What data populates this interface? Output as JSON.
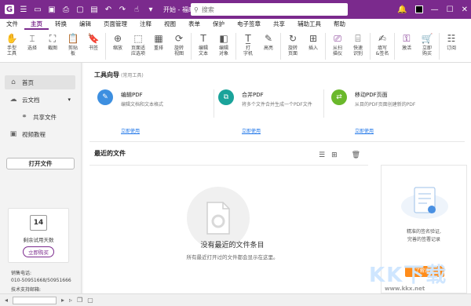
{
  "titlebar": {
    "title": "开始 - 福昕高级PDF...",
    "search_placeholder": "搜索",
    "bg_color": "#7b2a8d"
  },
  "menu": [
    "文件",
    "主页",
    "转换",
    "编辑",
    "页面管理",
    "注释",
    "视图",
    "表单",
    "保护",
    "电子签章",
    "共享",
    "辅助工具",
    "帮助"
  ],
  "ribbon": [
    {
      "label": "手型\n工具",
      "icon": "hand-icon"
    },
    {
      "label": "选择",
      "icon": "select-icon"
    },
    {
      "label": "截图",
      "icon": "screenshot-icon"
    },
    {
      "label": "剪贴\n板",
      "icon": "clipboard-icon"
    },
    {
      "label": "书签",
      "icon": "bookmark-icon"
    },
    {
      "label": "缩放",
      "icon": "zoom-icon"
    },
    {
      "label": "页面适\n应选项",
      "icon": "fit-page-icon"
    },
    {
      "label": "重排",
      "icon": "reflow-icon"
    },
    {
      "label": "旋转\n视图",
      "icon": "rotate-view-icon"
    },
    {
      "label": "编辑\n文本",
      "icon": "edit-text-icon"
    },
    {
      "label": "编辑\n对象",
      "icon": "edit-object-icon"
    },
    {
      "label": "打\n字机",
      "icon": "typewriter-icon"
    },
    {
      "label": "高亮",
      "icon": "highlight-icon"
    },
    {
      "label": "旋转\n页面",
      "icon": "rotate-page-icon"
    },
    {
      "label": "插入",
      "icon": "insert-icon"
    },
    {
      "label": "从扫\n描仪",
      "icon": "scanner-icon"
    },
    {
      "label": "快速\n识别",
      "icon": "ocr-icon"
    },
    {
      "label": "填写\n&签名",
      "icon": "fill-sign-icon"
    },
    {
      "label": "激活",
      "icon": "activate-icon"
    },
    {
      "label": "立即\n购买",
      "icon": "cart-icon"
    },
    {
      "label": "订阅",
      "icon": "subscribe-icon"
    }
  ],
  "sidebar": {
    "home": "首页",
    "cloud": "云文档",
    "shared": "共享文件",
    "video": "视频教程",
    "open_file": "打开文件",
    "trial_days": "14",
    "trial_text": "剩余试用天数",
    "buy_now": "立即购买",
    "phone_label": "销售电话:",
    "phone": "010-50951668/50951666",
    "support": "技术支持邮箱:"
  },
  "tool_guide": {
    "title": "工具向导",
    "subtitle": "(常用工具)",
    "cards": [
      {
        "name": "编辑PDF",
        "desc": "编辑文档和文本格式",
        "link": "立即使用",
        "color": "#3d8fe0"
      },
      {
        "name": "合并PDF",
        "desc": "将多个文件合并生成一个PDF文件",
        "link": "立即使用",
        "color": "#1aa39a"
      },
      {
        "name": "移动PDF页面",
        "desc": "从目的PDF页面创建新的PDF",
        "link": "立即使用",
        "color": "#6ab82b"
      }
    ]
  },
  "recent": {
    "title": "最近的文件",
    "empty_title": "没有最近的文件条目",
    "empty_desc": "所有最近打开过的文件都会显示在这里。"
  },
  "ad": {
    "line1": "精准的签名验证,",
    "line2": "完善的签署记录",
    "button": "了解详情"
  },
  "watermark": {
    "text": "KK下载",
    "url": "www.kkx.net"
  }
}
